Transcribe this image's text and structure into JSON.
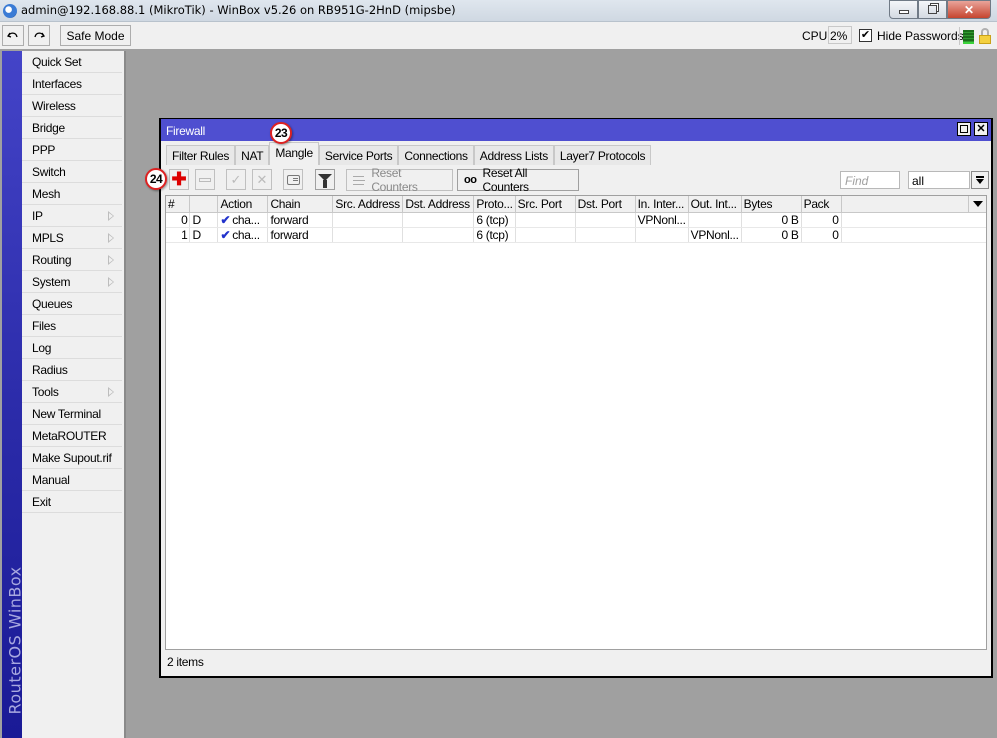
{
  "window": {
    "title": "admin@192.168.88.1 (MikroTik) - WinBox v5.26 on RB951G-2HnD (mipsbe)",
    "controls": [
      "minimize",
      "maximize",
      "close"
    ]
  },
  "toolbar": {
    "undo_icon": "undo-icon",
    "redo_icon": "redo-icon",
    "safe_mode_label": "Safe Mode",
    "cpu_label": "CPU:",
    "cpu_value": "2%",
    "hide_passwords_checked": true,
    "hide_passwords_label": "Hide Passwords",
    "check_mark": "✔"
  },
  "sidebar": {
    "brand": "RouterOS WinBox",
    "items": [
      {
        "label": "Quick Set",
        "submenu": false
      },
      {
        "label": "Interfaces",
        "submenu": false
      },
      {
        "label": "Wireless",
        "submenu": false
      },
      {
        "label": "Bridge",
        "submenu": false
      },
      {
        "label": "PPP",
        "submenu": false
      },
      {
        "label": "Switch",
        "submenu": false
      },
      {
        "label": "Mesh",
        "submenu": false
      },
      {
        "label": "IP",
        "submenu": true
      },
      {
        "label": "MPLS",
        "submenu": true
      },
      {
        "label": "Routing",
        "submenu": true
      },
      {
        "label": "System",
        "submenu": true
      },
      {
        "label": "Queues",
        "submenu": false
      },
      {
        "label": "Files",
        "submenu": false
      },
      {
        "label": "Log",
        "submenu": false
      },
      {
        "label": "Radius",
        "submenu": false
      },
      {
        "label": "Tools",
        "submenu": true
      },
      {
        "label": "New Terminal",
        "submenu": false
      },
      {
        "label": "MetaROUTER",
        "submenu": false
      },
      {
        "label": "Make Supout.rif",
        "submenu": false
      },
      {
        "label": "Manual",
        "submenu": false
      },
      {
        "label": "Exit",
        "submenu": false
      }
    ]
  },
  "firewall": {
    "title": "Firewall",
    "close_glyph": "✕",
    "tabs": [
      {
        "label": "Filter Rules",
        "active": false
      },
      {
        "label": "NAT",
        "active": false
      },
      {
        "label": "Mangle",
        "active": true
      },
      {
        "label": "Service Ports",
        "active": false
      },
      {
        "label": "Connections",
        "active": false
      },
      {
        "label": "Address Lists",
        "active": false
      },
      {
        "label": "Layer7 Protocols",
        "active": false
      }
    ],
    "annotations": {
      "tab_badge": "23",
      "add_badge": "24"
    },
    "toolbar": {
      "add_glyph": "✚",
      "enable_glyph": "✓",
      "disable_glyph": "✕",
      "reset_counters_label": "Reset Counters",
      "reset_all_counters_icon": "oo",
      "reset_all_counters_label": "Reset All Counters",
      "find_placeholder": "Find",
      "filter_value": "all"
    },
    "table": {
      "columns": [
        "#",
        "",
        "Action",
        "Chain",
        "Src. Address",
        "Dst. Address",
        "Proto...",
        "Src. Port",
        "Dst. Port",
        "In. Inter...",
        "Out. Int...",
        "Bytes",
        "Pack"
      ],
      "rows": [
        {
          "num": "0",
          "flag": "D",
          "action_icon": "✔",
          "action": "cha...",
          "chain": "forward",
          "src_address": "",
          "dst_address": "",
          "protocol": "6 (tcp)",
          "src_port": "",
          "dst_port": "",
          "in_interface": "VPNonl...",
          "out_interface": "",
          "bytes": "0 B",
          "packets": "0"
        },
        {
          "num": "1",
          "flag": "D",
          "action_icon": "✔",
          "action": "cha...",
          "chain": "forward",
          "src_address": "",
          "dst_address": "",
          "protocol": "6 (tcp)",
          "src_port": "",
          "dst_port": "",
          "in_interface": "",
          "out_interface": "VPNonl...",
          "bytes": "0 B",
          "packets": "0"
        }
      ]
    },
    "status": "2 items"
  }
}
